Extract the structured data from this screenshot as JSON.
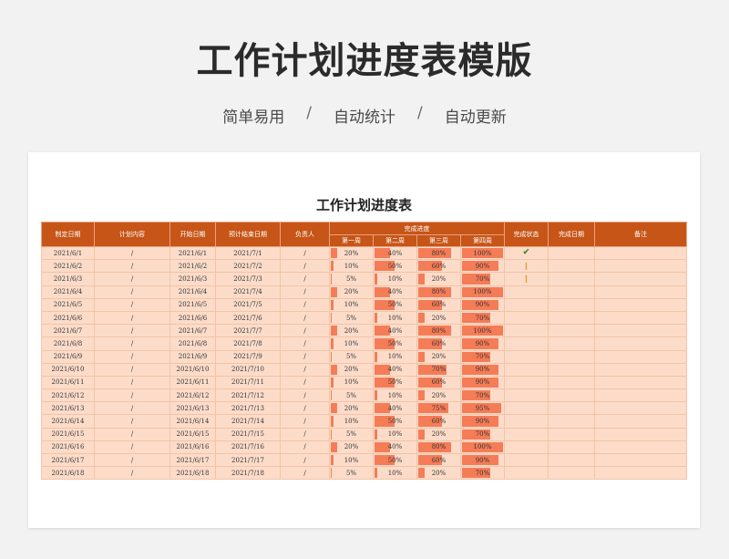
{
  "hero": {
    "title": "工作计划进度表模版",
    "features": [
      "简单易用",
      "自动统计",
      "自动更新"
    ],
    "separator": "/"
  },
  "sheet": {
    "title": "工作计划进度表",
    "headers": {
      "made_date": "制定日期",
      "plan_content": "计划内容",
      "start_date": "开始日期",
      "planned_end": "预计结束日期",
      "owner": "负责人",
      "progress_group": "完成进度",
      "weeks": [
        "第一周",
        "第二周",
        "第三周",
        "第四周"
      ],
      "status": "完成状态",
      "done_date": "完成日期",
      "remarks": "备注"
    },
    "colors": {
      "header_bg": "#c65517",
      "cell_bg": "#fcdcc9",
      "bar": "#f47c57",
      "done_check": "#3f8f3a",
      "pending": "#d6a23a"
    },
    "rows": [
      {
        "made": "2021/6/1",
        "content": "/",
        "start": "2021/6/1",
        "end": "2021/7/1",
        "owner": "/",
        "w": [
          "20%",
          "40%",
          "80%",
          "100%"
        ],
        "status": "done-check-icon"
      },
      {
        "made": "2021/6/2",
        "content": "/",
        "start": "2021/6/2",
        "end": "2021/7/2",
        "owner": "/",
        "w": [
          "10%",
          "50%",
          "60%",
          "90%"
        ],
        "status": "pending-icon"
      },
      {
        "made": "2021/6/3",
        "content": "/",
        "start": "2021/6/3",
        "end": "2021/7/3",
        "owner": "/",
        "w": [
          "5%",
          "10%",
          "20%",
          "70%"
        ],
        "status": "pending-icon"
      },
      {
        "made": "2021/6/4",
        "content": "/",
        "start": "2021/6/4",
        "end": "2021/7/4",
        "owner": "/",
        "w": [
          "20%",
          "40%",
          "80%",
          "100%"
        ],
        "status": ""
      },
      {
        "made": "2021/6/5",
        "content": "/",
        "start": "2021/6/5",
        "end": "2021/7/5",
        "owner": "/",
        "w": [
          "10%",
          "50%",
          "60%",
          "90%"
        ],
        "status": ""
      },
      {
        "made": "2021/6/6",
        "content": "/",
        "start": "2021/6/6",
        "end": "2021/7/6",
        "owner": "/",
        "w": [
          "5%",
          "10%",
          "20%",
          "70%"
        ],
        "status": ""
      },
      {
        "made": "2021/6/7",
        "content": "/",
        "start": "2021/6/7",
        "end": "2021/7/7",
        "owner": "/",
        "w": [
          "20%",
          "40%",
          "80%",
          "100%"
        ],
        "status": ""
      },
      {
        "made": "2021/6/8",
        "content": "/",
        "start": "2021/6/8",
        "end": "2021/7/8",
        "owner": "/",
        "w": [
          "10%",
          "50%",
          "60%",
          "90%"
        ],
        "status": ""
      },
      {
        "made": "2021/6/9",
        "content": "/",
        "start": "2021/6/9",
        "end": "2021/7/9",
        "owner": "/",
        "w": [
          "5%",
          "10%",
          "20%",
          "70%"
        ],
        "status": ""
      },
      {
        "made": "2021/6/10",
        "content": "/",
        "start": "2021/6/10",
        "end": "2021/7/10",
        "owner": "/",
        "w": [
          "20%",
          "40%",
          "70%",
          "90%"
        ],
        "status": ""
      },
      {
        "made": "2021/6/11",
        "content": "/",
        "start": "2021/6/11",
        "end": "2021/7/11",
        "owner": "/",
        "w": [
          "10%",
          "50%",
          "60%",
          "90%"
        ],
        "status": ""
      },
      {
        "made": "2021/6/12",
        "content": "/",
        "start": "2021/6/12",
        "end": "2021/7/12",
        "owner": "/",
        "w": [
          "5%",
          "10%",
          "20%",
          "70%"
        ],
        "status": ""
      },
      {
        "made": "2021/6/13",
        "content": "/",
        "start": "2021/6/13",
        "end": "2021/7/13",
        "owner": "/",
        "w": [
          "20%",
          "40%",
          "75%",
          "95%"
        ],
        "status": ""
      },
      {
        "made": "2021/6/14",
        "content": "/",
        "start": "2021/6/14",
        "end": "2021/7/14",
        "owner": "/",
        "w": [
          "10%",
          "50%",
          "60%",
          "90%"
        ],
        "status": ""
      },
      {
        "made": "2021/6/15",
        "content": "/",
        "start": "2021/6/15",
        "end": "2021/7/15",
        "owner": "/",
        "w": [
          "5%",
          "10%",
          "20%",
          "70%"
        ],
        "status": ""
      },
      {
        "made": "2021/6/16",
        "content": "/",
        "start": "2021/6/16",
        "end": "2021/7/16",
        "owner": "/",
        "w": [
          "20%",
          "40%",
          "80%",
          "100%"
        ],
        "status": ""
      },
      {
        "made": "2021/6/17",
        "content": "/",
        "start": "2021/6/17",
        "end": "2021/7/17",
        "owner": "/",
        "w": [
          "10%",
          "50%",
          "60%",
          "90%"
        ],
        "status": ""
      },
      {
        "made": "2021/6/18",
        "content": "/",
        "start": "2021/6/18",
        "end": "2021/7/18",
        "owner": "/",
        "w": [
          "5%",
          "10%",
          "20%",
          "70%"
        ],
        "status": ""
      }
    ]
  }
}
